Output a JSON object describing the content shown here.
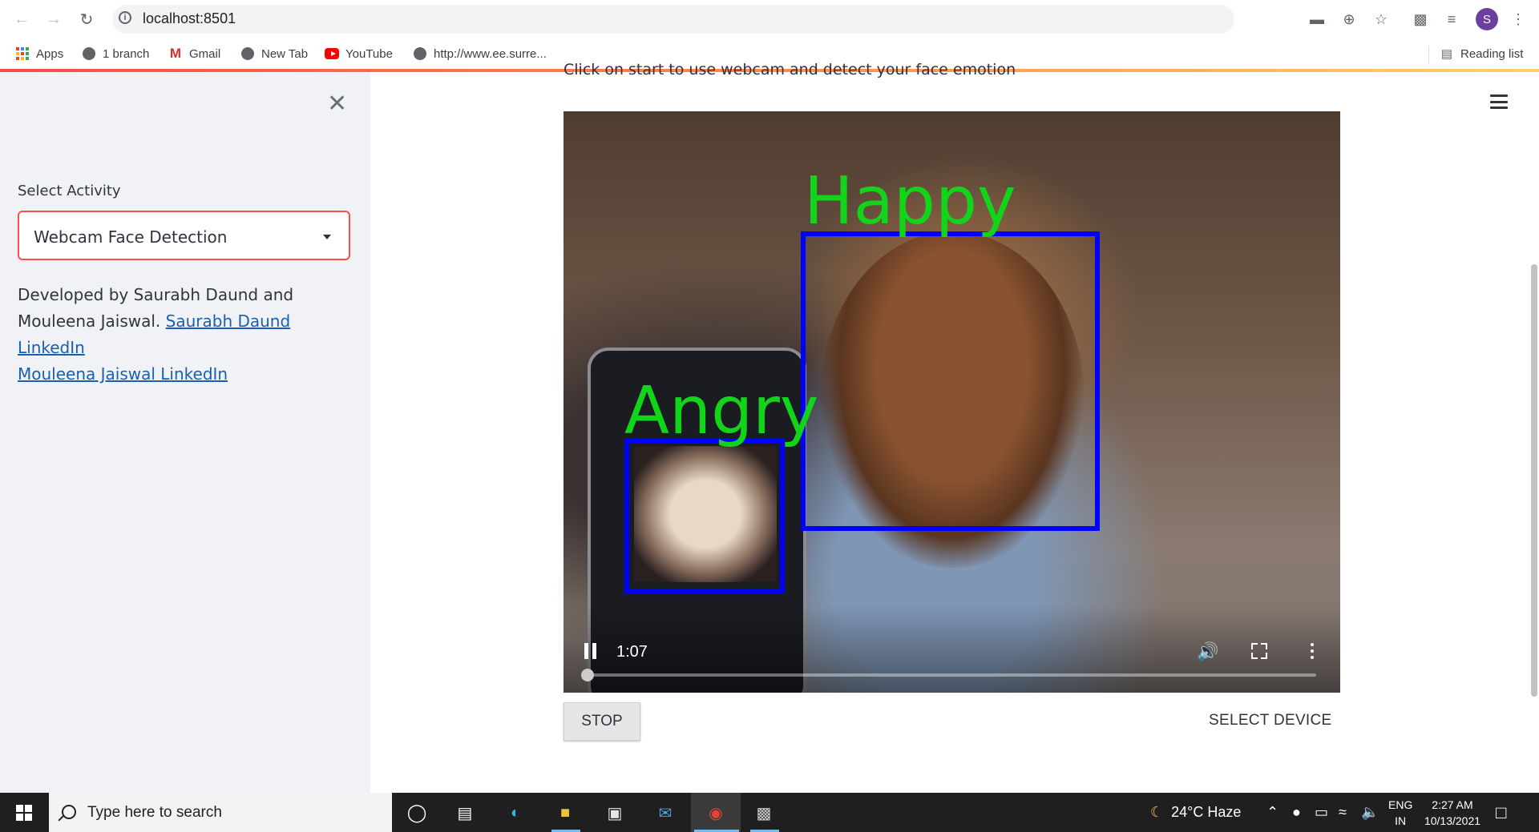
{
  "browser": {
    "url": "localhost:8501",
    "profile_initial": "S",
    "bookmarks": [
      {
        "label": "Apps"
      },
      {
        "label": "1 branch"
      },
      {
        "label": "Gmail"
      },
      {
        "label": "New Tab"
      },
      {
        "label": "YouTube"
      },
      {
        "label": "http://www.ee.surre..."
      }
    ],
    "reading_list": "Reading list"
  },
  "sidebar": {
    "select_label": "Select Activity",
    "select_value": "Webcam Face Detection",
    "credit_text": "Developed by Saurabh Daund and Mouleena Jaiswal.",
    "link1": "Saurabh Daund LinkedIn",
    "link2": "Mouleena Jaiswal LinkedIn"
  },
  "main": {
    "instruction": "Click on start to use webcam and detect your face emotion",
    "video": {
      "time": "1:07",
      "progress": 0.0,
      "labels": [
        "Happy",
        "Angry"
      ]
    },
    "stop_label": "STOP",
    "select_device_label": "SELECT DEVICE"
  },
  "taskbar": {
    "search_placeholder": "Type here to search",
    "weather": "24°C  Haze",
    "lang_top": "ENG",
    "lang_bottom": "IN",
    "time": "2:27 AM",
    "date": "10/13/2021"
  }
}
